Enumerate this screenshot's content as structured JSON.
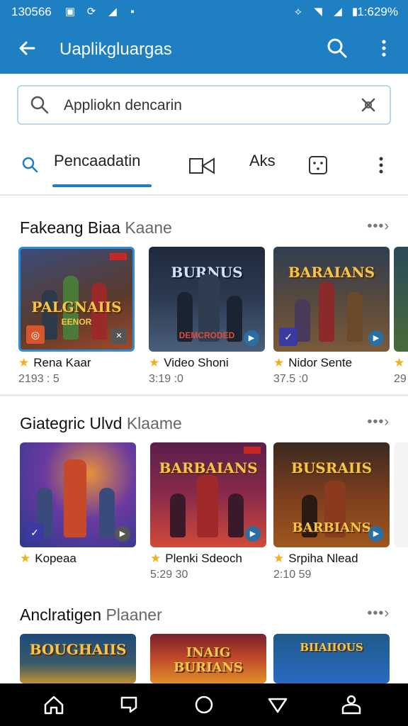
{
  "status": {
    "time": "130566",
    "battery": "1:629%"
  },
  "appbar": {
    "title": "Uaplikgluargas"
  },
  "search": {
    "placeholder": "Appliokn dencarin"
  },
  "tabs": [
    {
      "label": "Pencaadatin",
      "active": true
    },
    {
      "label": "",
      "icon": "video-icon"
    },
    {
      "label": "Aks"
    },
    {
      "label": "",
      "icon": "dice-icon"
    }
  ],
  "sections": [
    {
      "title": "Fakeang Biaa",
      "title_muted": "Kaane",
      "items": [
        {
          "art_title": "PALGNAIIS",
          "art_sub": "EENOR",
          "name": "Rena Kaar",
          "meta": "2193 : 5",
          "colors": [
            "#3b4c7a",
            "#a04a2a"
          ]
        },
        {
          "art_title": "BURNUS",
          "art_sub": "DEMCRODED",
          "name": "Video Shoni",
          "meta": "3:19 :0",
          "colors": [
            "#1f2a3c",
            "#4a5f7a"
          ]
        },
        {
          "art_title": "BARAIANS",
          "art_sub": "",
          "name": "Nidor Sente",
          "meta": "37.5 :0",
          "colors": [
            "#2f3e52",
            "#7a5a3a"
          ]
        }
      ]
    },
    {
      "title": "Giategric Ulvd",
      "title_muted": "Klaame",
      "items": [
        {
          "art_title": "",
          "art_sub": "",
          "name": "Kopeaa",
          "meta": "",
          "colors": [
            "#2a3a8a",
            "#c64a2a"
          ]
        },
        {
          "art_title": "BARBAIANS",
          "art_sub": "",
          "name": "Plenki Sdeoch",
          "meta": "5:29 30",
          "colors": [
            "#5a1f4a",
            "#d24a3a"
          ]
        },
        {
          "art_title": "BUSRAIIS",
          "art_sub": "BARBIANS",
          "name": "Srpiha Nlead",
          "meta": "2:10 59",
          "colors": [
            "#3a2a22",
            "#a0561e"
          ]
        }
      ]
    },
    {
      "title": "Anclratigen",
      "title_muted": "Plaaner",
      "items": [
        {
          "art_title": "BOUGHAIIS",
          "art_sub": "",
          "name": "",
          "meta": "",
          "colors": [
            "#1f4a7a",
            "#c09030"
          ]
        },
        {
          "art_title": "INAIG BURIANS",
          "art_sub": "",
          "name": "",
          "meta": "",
          "colors": [
            "#7a1f2a",
            "#e0902a"
          ]
        },
        {
          "art_title": "BIIAIIOUS",
          "art_sub": "",
          "name": "",
          "meta": "",
          "colors": [
            "#1f5a8a",
            "#2a6ac0"
          ]
        }
      ]
    }
  ],
  "peek_meta": "29"
}
